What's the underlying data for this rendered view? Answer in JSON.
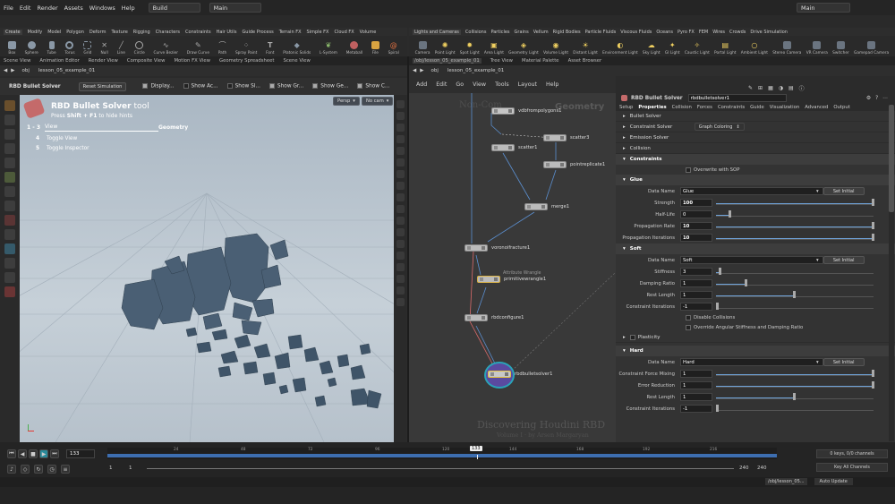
{
  "menubar": {
    "items": [
      "File",
      "Edit",
      "Render",
      "Assets",
      "Windows",
      "Help"
    ],
    "desktop": "Build",
    "scene": "Main",
    "right_scene": "Main"
  },
  "shelf_left": {
    "tabs": [
      "Create",
      "Modify",
      "Model",
      "Polygon",
      "Deform",
      "Texture",
      "Rigging",
      "Characters",
      "Constraints",
      "Hair Utils",
      "Guide Process",
      "Terrain FX",
      "Simple FX",
      "Cloud FX",
      "Volume"
    ],
    "tools": [
      "Box",
      "Sphere",
      "Tube",
      "Torus",
      "Grid",
      "Null",
      "Line",
      "Circle",
      "Curve Bezier",
      "Draw Curve",
      "Path",
      "Spray Paint",
      "Font",
      "Platonic Solids",
      "L-System",
      "Metaball",
      "File",
      "Spiral"
    ]
  },
  "shelf_right": {
    "tabs": [
      "Lights and Cameras",
      "Collisions",
      "Particles",
      "Grains",
      "Vellum",
      "Rigid Bodies",
      "Particle Fluids",
      "Viscous Fluids",
      "Oceans",
      "Pyro FX",
      "FEM",
      "Wires",
      "Crowds",
      "Drive Simulation"
    ],
    "tools": [
      "Camera",
      "Point Light",
      "Spot Light",
      "Area Light",
      "Geometry Light",
      "Volume Light",
      "Distant Light",
      "Environment Light",
      "Sky Light",
      "GI Light",
      "Caustic Light",
      "Portal Light",
      "Ambient Light",
      "Stereo Camera",
      "VR Camera",
      "Switcher",
      "Gamepad Camera"
    ]
  },
  "left_pane": {
    "tabs": [
      "Scene View",
      "Animation Editor",
      "Render View",
      "Composite View",
      "Motion FX View",
      "Geometry Spreadsheet",
      "Scene View"
    ],
    "path": [
      "obj",
      "lesson_05_example_01"
    ],
    "tool_name": "RBD Bullet Solver",
    "reset_label": "Reset Simulation",
    "options": [
      "Display...",
      "Show Ac...",
      "Show Sl...",
      "Show Gr...",
      "Show Ge...",
      "Show C..."
    ],
    "options_checked": [
      true,
      false,
      false,
      true,
      true,
      true
    ]
  },
  "viewport": {
    "hint_title_main": "RBD Bullet Solver",
    "hint_title_suffix": "tool",
    "hint_sub_pre": "Press",
    "hint_sub_key": "Shift + F1",
    "hint_sub_post": "to hide hints",
    "hint_row_key": "1 - 3",
    "hint_row_view": "View",
    "hint_row_geometry": "Geometry",
    "hint_items": [
      {
        "key": "4",
        "label": "Toggle View"
      },
      {
        "key": "5",
        "label": "Toggle Inspector"
      }
    ],
    "persp": "Persp",
    "cam": "No cam"
  },
  "right_pane": {
    "path_tab": "/obj/lesson_05_example_01",
    "tabs": [
      "Tree View",
      "Material Palette",
      "Asset Browser"
    ],
    "path": [
      "obj",
      "lesson_05_example_01"
    ],
    "menu": [
      "Add",
      "Edit",
      "Go",
      "View",
      "Tools",
      "Layout",
      "Help"
    ]
  },
  "network": {
    "watermark_left": "Non-Com",
    "watermark_right": "Geometry",
    "watermark_title": "Discovering Houdini RBD",
    "watermark_sub": "Volume I · by Arsen Margaryan",
    "nodes": [
      {
        "name": "vdbfrompolygons1"
      },
      {
        "name": "scatter1"
      },
      {
        "name": "scatter3"
      },
      {
        "name": "pointreplicate1"
      },
      {
        "name": "merge1"
      },
      {
        "name": "voronoifracture1"
      },
      {
        "name": "primitivewrangle1",
        "comment": "Attribute Wrangle"
      },
      {
        "name": "rbdconfigure1"
      },
      {
        "name": "rbdbulletsolver1"
      }
    ]
  },
  "params": {
    "header_type": "RBD Bullet Solver",
    "header_name": "rbdbulletsolver1",
    "tabs": [
      "Setup",
      "Properties",
      "Collision",
      "Forces",
      "Constraints",
      "Guide",
      "Visualization",
      "Advanced",
      "Output"
    ],
    "sections_top": [
      "Bullet Solver",
      "Constraint Solver",
      "Emission Solver",
      "Collision"
    ],
    "graph_coloring": "Graph Coloring",
    "constraints_head": "Constraints",
    "overwrite": "Overwrite with SOP",
    "set_initial": "Set Initial",
    "glue": {
      "head": "Glue",
      "data_name": "Glue",
      "strength": "100",
      "half_life": "0",
      "propagation_rate": "10",
      "propagation_iterations": "10",
      "labels": [
        "Data Name",
        "Strength",
        "Half-Life",
        "Propagation Rate",
        "Propagation Iterations"
      ]
    },
    "soft": {
      "head": "Soft",
      "data_name": "Soft",
      "stiffness": "3",
      "damping_ratio": "1",
      "rest_length": "1",
      "constraint_iterations": "-1",
      "labels": [
        "Data Name",
        "Stiffness",
        "Damping Ratio",
        "Rest Length",
        "Constraint Iterations"
      ],
      "disable_collisions": "Disable Collisions",
      "override": "Override Angular Stiffness and Damping Ratio"
    },
    "plasticity": "Plasticity",
    "hard": {
      "head": "Hard",
      "data_name": "Hard",
      "force_mixing": "1",
      "error_reduction": "1",
      "rest_length": "1",
      "constraint_iterations": "-1",
      "labels": [
        "Data Name",
        "Constraint Force Mixing",
        "Error Reduction",
        "Rest Length",
        "Constraint Iterations"
      ]
    }
  },
  "timeline": {
    "current_frame": "133",
    "start": "1",
    "start2": "1",
    "end": "240",
    "end2": "240",
    "ticks": [
      "24",
      "48",
      "72",
      "96",
      "120",
      "144",
      "168",
      "192",
      "216"
    ],
    "keys_info": "0 keys, 0/0 channels",
    "key_all": "Key All Channels",
    "status_path": "/obj/lesson_05...",
    "auto_update": "Auto Update"
  },
  "colors": {
    "accent": "#3d6eb0",
    "node_highlight": "#2aa3b8",
    "selected": "#e0c040"
  }
}
